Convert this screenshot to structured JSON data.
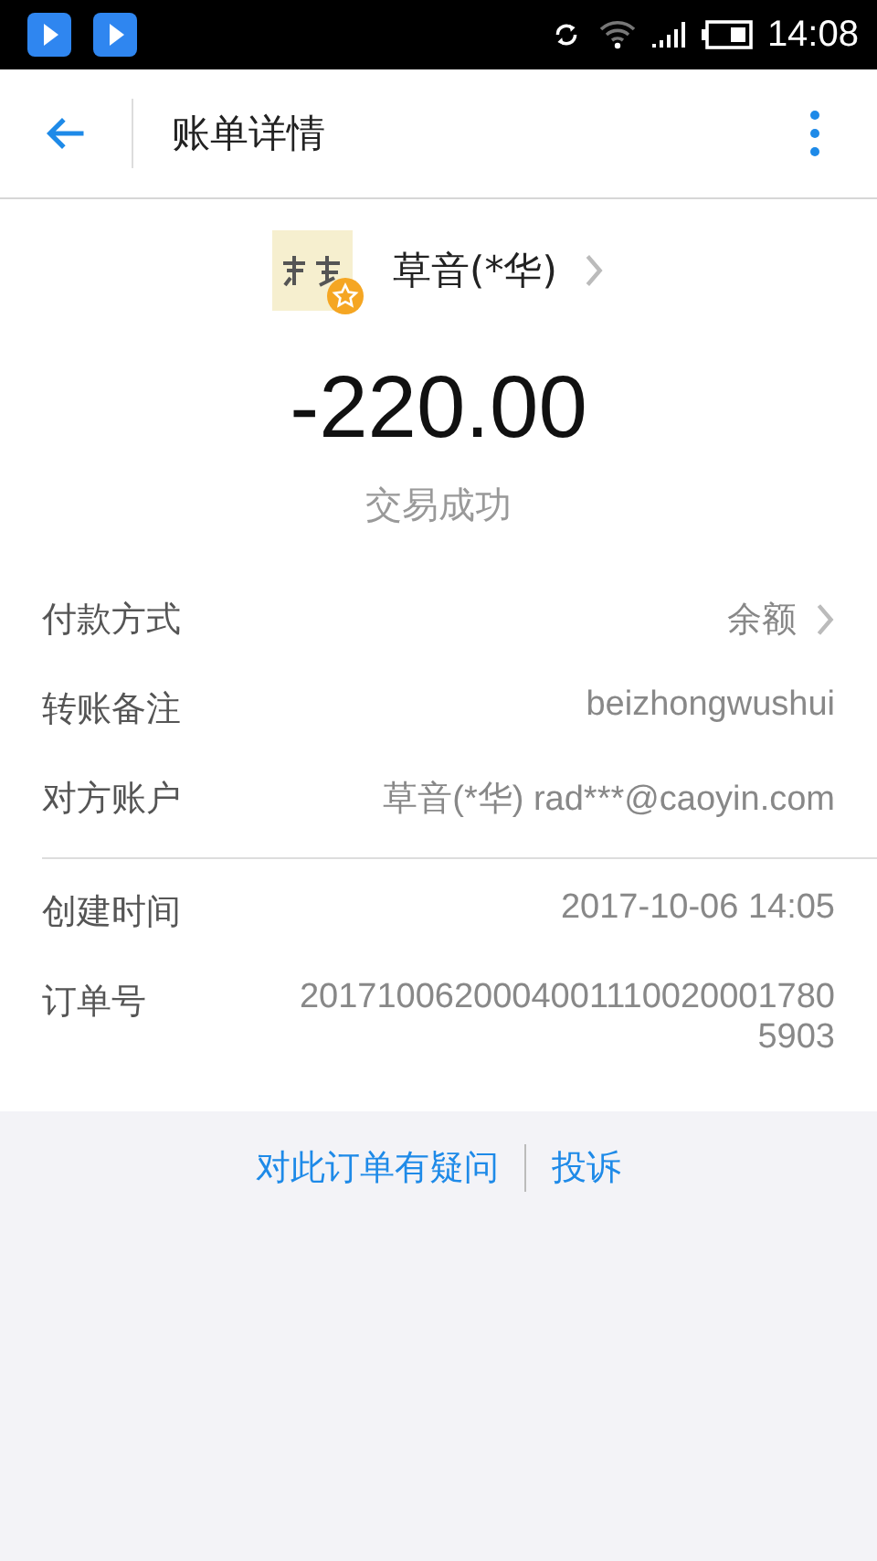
{
  "status_bar": {
    "time": "14:08"
  },
  "header": {
    "title": "账单详情"
  },
  "payee": {
    "name": "草音(*华)"
  },
  "amount": "-220.00",
  "status": "交易成功",
  "detail_groups": [
    [
      {
        "label": "付款方式",
        "value": "余额",
        "chevron": true
      },
      {
        "label": "转账备注",
        "value": "beizhongwushui",
        "chevron": false
      },
      {
        "label": "对方账户",
        "value": "草音(*华) rad***@caoyin.com",
        "chevron": false
      }
    ],
    [
      {
        "label": "创建时间",
        "value": "2017-10-06 14:05",
        "chevron": false
      },
      {
        "label": "订单号",
        "value": "20171006200040011100200017805903",
        "chevron": false
      }
    ]
  ],
  "footer_links": [
    "对此订单有疑问",
    "投诉"
  ]
}
